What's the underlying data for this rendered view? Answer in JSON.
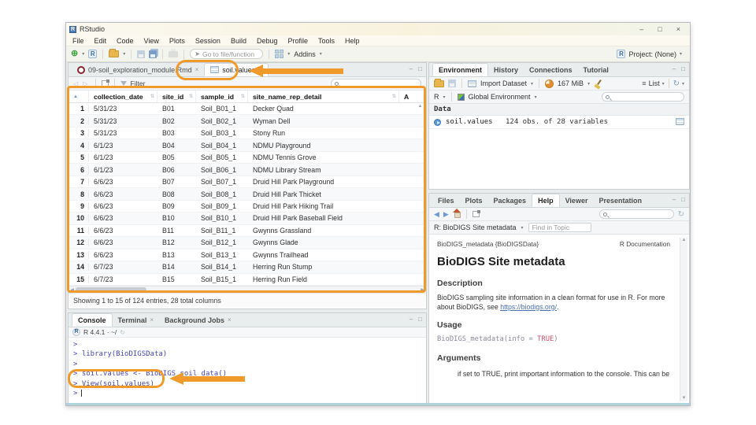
{
  "window": {
    "title": "RStudio",
    "controls": {
      "minimize": "–",
      "maximize": "□",
      "close": "×"
    }
  },
  "glyphs": {
    "caret": "▾",
    "close": "×",
    "sort": "⇅",
    "sort_asc": "▲",
    "up": "▲",
    "down": "▼",
    "left": "◀",
    "right": "▶",
    "minimize": "–",
    "maximize": "□",
    "menu_lines": "≡",
    "refresh": "↻",
    "plus": "⊕",
    "back": "◀",
    "forward": "▶",
    "nav_back_fwd": "◁ ▷",
    "link": "↻",
    "r_letter": "R"
  },
  "menu": {
    "items": [
      "File",
      "Edit",
      "Code",
      "View",
      "Plots",
      "Session",
      "Build",
      "Debug",
      "Profile",
      "Tools",
      "Help"
    ]
  },
  "toolbar": {
    "goto_placeholder": "Go to file/function",
    "addins_label": "Addins",
    "project_label": "Project: (None)"
  },
  "source_pane": {
    "tabs": [
      {
        "label": "09-soil_exploration_module.Rmd"
      },
      {
        "label": "soil.values"
      }
    ],
    "filter_label": "Filter",
    "table": {
      "columns": [
        "collection_date",
        "site_id",
        "sample_id",
        "site_name_rep_detail"
      ],
      "partial_column": "A",
      "rows": [
        [
          "1",
          "5/31/23",
          "B01",
          "Soil_B01_1",
          "Decker Quad"
        ],
        [
          "2",
          "5/31/23",
          "B02",
          "Soil_B02_1",
          "Wyman Dell"
        ],
        [
          "3",
          "5/31/23",
          "B03",
          "Soil_B03_1",
          "Stony Run"
        ],
        [
          "4",
          "6/1/23",
          "B04",
          "Soil_B04_1",
          "NDMU Playground"
        ],
        [
          "5",
          "6/1/23",
          "B05",
          "Soil_B05_1",
          "NDMU Tennis Grove"
        ],
        [
          "6",
          "6/1/23",
          "B06",
          "Soil_B06_1",
          "NDMU Library Stream"
        ],
        [
          "7",
          "6/6/23",
          "B07",
          "Soil_B07_1",
          "Druid Hill Park Playground"
        ],
        [
          "8",
          "6/6/23",
          "B08",
          "Soil_B08_1",
          "Druid Hill Park Thicket"
        ],
        [
          "9",
          "6/6/23",
          "B09",
          "Soil_B09_1",
          "Druid Hill Park Hiking Trail"
        ],
        [
          "10",
          "6/6/23",
          "B10",
          "Soil_B10_1",
          "Druid Hill Park Baseball Field"
        ],
        [
          "11",
          "6/6/23",
          "B11",
          "Soil_B11_1",
          "Gwynns Grassland"
        ],
        [
          "12",
          "6/6/23",
          "B12",
          "Soil_B12_1",
          "Gwynns Glade"
        ],
        [
          "13",
          "6/6/23",
          "B13",
          "Soil_B13_1",
          "Gwynns Trailhead"
        ],
        [
          "14",
          "6/7/23",
          "B14",
          "Soil_B14_1",
          "Herring Run Stump"
        ],
        [
          "15",
          "6/7/23",
          "B15",
          "Soil_B15_1",
          "Herring Run Field"
        ]
      ],
      "status": "Showing 1 to 15 of 124 entries, 28 total columns"
    }
  },
  "console_pane": {
    "tabs": [
      "Console",
      "Terminal",
      "Background Jobs"
    ],
    "r_version": "R 4.4.1 · ~/",
    "lines": [
      ">",
      "> library(BioDIGSData)",
      ">",
      "> soil.values <- BioDIGS_soil_data()",
      "> View(soil.values)",
      ">"
    ]
  },
  "environment_pane": {
    "tabs": [
      "Environment",
      "History",
      "Connections",
      "Tutorial"
    ],
    "import_label": "Import Dataset",
    "memory_label": "167 MiB",
    "list_label": "List",
    "r_dropdown_label": "R",
    "scope_label": "Global Environment",
    "section_label": "Data",
    "entries": [
      {
        "name": "soil.values",
        "desc": "124 obs. of 28 variables"
      }
    ]
  },
  "help_pane": {
    "tabs": [
      "Files",
      "Plots",
      "Packages",
      "Help",
      "Viewer",
      "Presentation"
    ],
    "topic_label": "R: BioDIGS Site metadata",
    "find_placeholder": "Find in Topic",
    "doc": {
      "header_left": "BioDIGS_metadata {BioDIGSData}",
      "header_right": "R Documentation",
      "title": "BioDIGS Site metadata",
      "description_heading": "Description",
      "description_pre": "BioDIGS sampling site information in a clean format for use in R. For more about BioDIGS, see ",
      "description_link": "https://biodigs.org/",
      "description_post": ".",
      "usage_heading": "Usage",
      "usage_code_pre": "BioDIGS_metadata(info = ",
      "usage_code_true": "TRUE",
      "usage_code_post": ")",
      "arguments_heading": "Arguments",
      "arguments_partial": "if set to TRUE, print important information to the console. This can be"
    }
  },
  "colors": {
    "annotation_orange": "#F09A2C",
    "console_text_blue": "#4545B8",
    "link_blue": "#4A6FB5",
    "code_true_red": "#C94F68",
    "titlebar_cream": "#F8F2DD"
  }
}
